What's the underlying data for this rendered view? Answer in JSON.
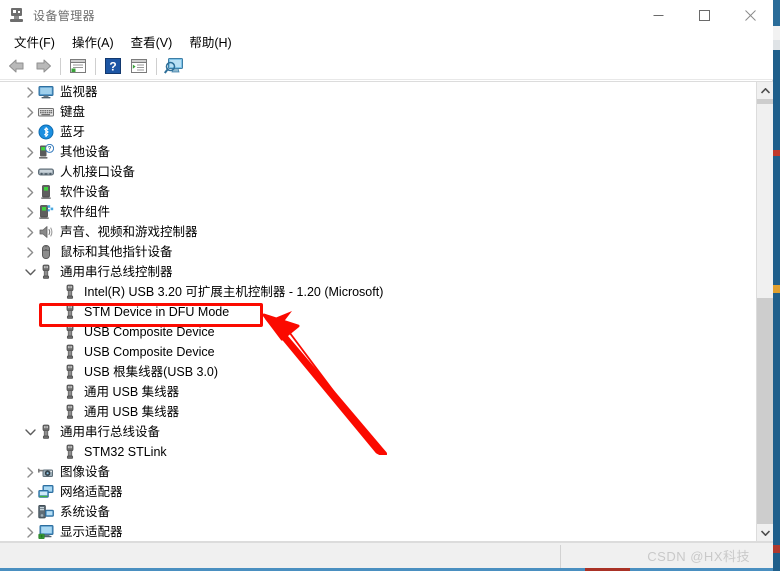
{
  "window": {
    "title": "设备管理器",
    "title_icon": "device-manager-icon",
    "controls": {
      "minimize": "minimize-icon",
      "maximize": "maximize-icon",
      "close": "close-icon"
    }
  },
  "menubar": {
    "items": [
      {
        "label": "文件(F)",
        "name": "menu-file"
      },
      {
        "label": "操作(A)",
        "name": "menu-action"
      },
      {
        "label": "查看(V)",
        "name": "menu-view"
      },
      {
        "label": "帮助(H)",
        "name": "menu-help"
      }
    ]
  },
  "toolbar": {
    "items": [
      {
        "name": "back-button",
        "icon": "back-arrow-icon"
      },
      {
        "name": "forward-button",
        "icon": "forward-arrow-icon"
      },
      {
        "name": "properties-button",
        "icon": "properties-window-icon"
      },
      {
        "name": "help-button",
        "icon": "question-mark-icon"
      },
      {
        "name": "update-driver-button",
        "icon": "window-play-icon"
      },
      {
        "name": "scan-hardware-button",
        "icon": "scan-monitor-icon"
      }
    ]
  },
  "tree": {
    "rows": [
      {
        "label": "监视器",
        "icon": "monitor-icon",
        "indent": 1,
        "expander": "collapsed"
      },
      {
        "label": "键盘",
        "icon": "keyboard-icon",
        "indent": 1,
        "expander": "collapsed"
      },
      {
        "label": "蓝牙",
        "icon": "bluetooth-icon",
        "indent": 1,
        "expander": "collapsed"
      },
      {
        "label": "其他设备",
        "icon": "unknown-device-icon",
        "indent": 1,
        "expander": "collapsed"
      },
      {
        "label": "人机接口设备",
        "icon": "hid-device-icon",
        "indent": 1,
        "expander": "collapsed"
      },
      {
        "label": "软件设备",
        "icon": "software-device-icon",
        "indent": 1,
        "expander": "collapsed"
      },
      {
        "label": "软件组件",
        "icon": "software-component-icon",
        "indent": 1,
        "expander": "collapsed"
      },
      {
        "label": "声音、视频和游戏控制器",
        "icon": "speaker-icon",
        "indent": 1,
        "expander": "collapsed"
      },
      {
        "label": "鼠标和其他指针设备",
        "icon": "mouse-icon",
        "indent": 1,
        "expander": "collapsed"
      },
      {
        "label": "通用串行总线控制器",
        "icon": "usb-icon",
        "indent": 1,
        "expander": "expanded"
      },
      {
        "label": "Intel(R) USB 3.20 可扩展主机控制器 - 1.20 (Microsoft)",
        "icon": "usb-icon",
        "indent": 2,
        "expander": "none"
      },
      {
        "label": "STM Device in DFU Mode",
        "icon": "usb-icon",
        "indent": 2,
        "expander": "none",
        "highlighted": true
      },
      {
        "label": "USB Composite Device",
        "icon": "usb-icon",
        "indent": 2,
        "expander": "none"
      },
      {
        "label": "USB Composite Device",
        "icon": "usb-icon",
        "indent": 2,
        "expander": "none"
      },
      {
        "label": "USB 根集线器(USB 3.0)",
        "icon": "usb-icon",
        "indent": 2,
        "expander": "none"
      },
      {
        "label": "通用 USB 集线器",
        "icon": "usb-icon",
        "indent": 2,
        "expander": "none"
      },
      {
        "label": "通用 USB 集线器",
        "icon": "usb-icon",
        "indent": 2,
        "expander": "none"
      },
      {
        "label": "通用串行总线设备",
        "icon": "usb-icon",
        "indent": 1,
        "expander": "expanded"
      },
      {
        "label": "STM32 STLink",
        "icon": "usb-icon",
        "indent": 2,
        "expander": "none"
      },
      {
        "label": "图像设备",
        "icon": "imaging-device-icon",
        "indent": 1,
        "expander": "collapsed"
      },
      {
        "label": "网络适配器",
        "icon": "network-adapter-icon",
        "indent": 1,
        "expander": "collapsed"
      },
      {
        "label": "系统设备",
        "icon": "system-device-icon",
        "indent": 1,
        "expander": "collapsed"
      },
      {
        "label": "显示适配器",
        "icon": "display-adapter-icon",
        "indent": 1,
        "expander": "collapsed"
      }
    ]
  },
  "scrollbar": {
    "up_arrow": "scroll-up-arrow-icon",
    "down_arrow": "scroll-down-arrow-icon",
    "thumb": "scroll-thumb"
  },
  "statusbar": {
    "left_text": "",
    "right_text": ""
  },
  "watermark": {
    "text": "CSDN @HX科技"
  },
  "annotations": {
    "highlight_box": {
      "target_label": "STM Device in DFU Mode",
      "color": "#fb0a00"
    },
    "arrow": {
      "color": "#fb0a00",
      "points_to": "STM Device in DFU Mode"
    }
  }
}
